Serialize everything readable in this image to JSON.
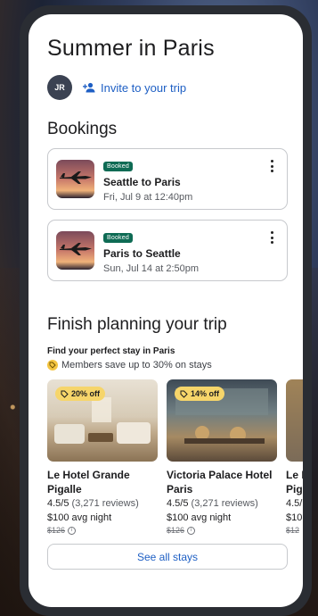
{
  "trip": {
    "title": "Summer in Paris",
    "avatar_initials": "JR",
    "invite_label": "Invite to your trip"
  },
  "bookings": {
    "heading": "Bookings",
    "items": [
      {
        "badge": "Booked",
        "title": "Seattle to Paris",
        "date": "Fri, Jul 9 at 12:40pm",
        "icon": "airplane-icon"
      },
      {
        "badge": "Booked",
        "title": "Paris to Seattle",
        "date": "Sun, Jul 14 at 2:50pm",
        "icon": "airplane-icon"
      }
    ]
  },
  "planning": {
    "heading": "Finish planning your trip",
    "subheading": "Find your perfect stay in Paris",
    "member_text": "Members save up to 30% on stays",
    "hotels": [
      {
        "discount": "20% off",
        "name": "Le Hotel Grande Pigalle",
        "rating": "4.5/5",
        "reviews": "(3,271 reviews)",
        "price": "$100 avg night",
        "old_price": "$126"
      },
      {
        "discount": "14% off",
        "name": "Victoria Palace Hotel Paris",
        "rating": "4.5/5",
        "reviews": "(3,271 reviews)",
        "price": "$100 avg night",
        "old_price": "$126"
      },
      {
        "discount": "",
        "name": "Le I Pig",
        "rating": "4.5/",
        "reviews": "",
        "price": "$10",
        "old_price": "$12"
      }
    ],
    "see_all_label": "See all stays"
  },
  "colors": {
    "accent_link": "#1e5fc4",
    "booked_badge": "#0e6b54",
    "discount_badge": "#f6d56a"
  }
}
